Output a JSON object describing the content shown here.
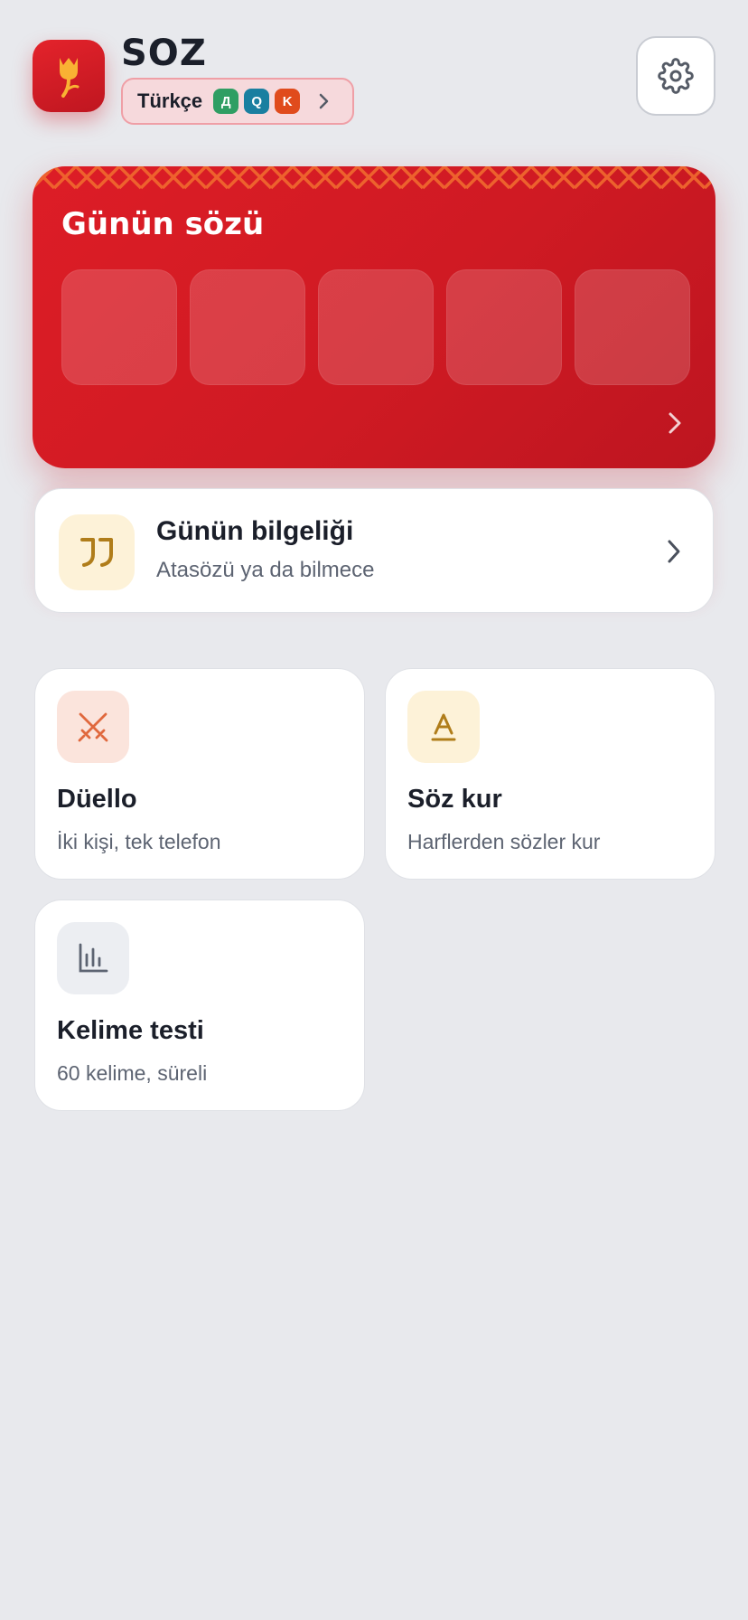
{
  "header": {
    "app_title": "SOZ",
    "language": {
      "label": "Türkçe",
      "badges": [
        {
          "text": "Д",
          "color": "#2f9e63"
        },
        {
          "text": "Q",
          "color": "#1a7fa0"
        },
        {
          "text": "K",
          "color": "#e04b1c"
        }
      ]
    },
    "icons": {
      "logo": "tulip-icon",
      "settings": "gear-icon",
      "language_chevron": "chevron-right-icon"
    }
  },
  "word_of_day": {
    "title": "Günün sözü",
    "tile_count": 5,
    "icons": {
      "chevron": "chevron-right-icon"
    },
    "colors": {
      "card": "#d41b24",
      "ornament": "#f05a28"
    }
  },
  "wisdom": {
    "title": "Günün bilgeliği",
    "subtitle": "Atasözü ya da bilmece",
    "icons": {
      "main": "quote-icon",
      "chevron": "chevron-right-icon"
    }
  },
  "games": [
    {
      "title": "Düello",
      "subtitle": "İki kişi, tek telefon",
      "icon": "crossed-swords-icon",
      "icon_bg": "#fbe4dc",
      "icon_color": "#e0683d"
    },
    {
      "title": "Söz kur",
      "subtitle": "Harflerden sözler kur",
      "icon": "letter-a-icon",
      "icon_bg": "#fdf2d8",
      "icon_color": "#b07d1a"
    },
    {
      "title": "Kelime testi",
      "subtitle": "60 kelime, süreli",
      "icon": "bar-chart-icon",
      "icon_bg": "#eceef2",
      "icon_color": "#5d6472"
    }
  ],
  "colors": {
    "background": "#e8e9ed",
    "accent": "#d41b24",
    "text": "#1b1f2a",
    "muted": "#5d6472"
  }
}
